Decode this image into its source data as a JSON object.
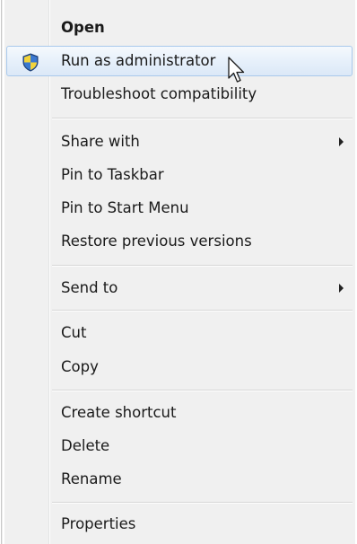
{
  "context_menu": {
    "items": [
      {
        "label": "Open"
      },
      {
        "label": "Run as administrator"
      },
      {
        "label": "Troubleshoot compatibility"
      },
      {
        "label": "Share with"
      },
      {
        "label": "Pin to Taskbar"
      },
      {
        "label": "Pin to Start Menu"
      },
      {
        "label": "Restore previous versions"
      },
      {
        "label": "Send to"
      },
      {
        "label": "Cut"
      },
      {
        "label": "Copy"
      },
      {
        "label": "Create shortcut"
      },
      {
        "label": "Delete"
      },
      {
        "label": "Rename"
      },
      {
        "label": "Properties"
      }
    ],
    "icons": {
      "run_as_admin": "uac-shield-icon",
      "share_with_submenu": "submenu-arrow-icon",
      "send_to_submenu": "submenu-arrow-icon",
      "pointer": "mouse-pointer-icon"
    },
    "colors": {
      "menu_background": "#f0f0f0",
      "highlight_border": "#a9c9ec",
      "highlight_fill": "#dbe8f7",
      "text": "#1a1a1a"
    }
  }
}
